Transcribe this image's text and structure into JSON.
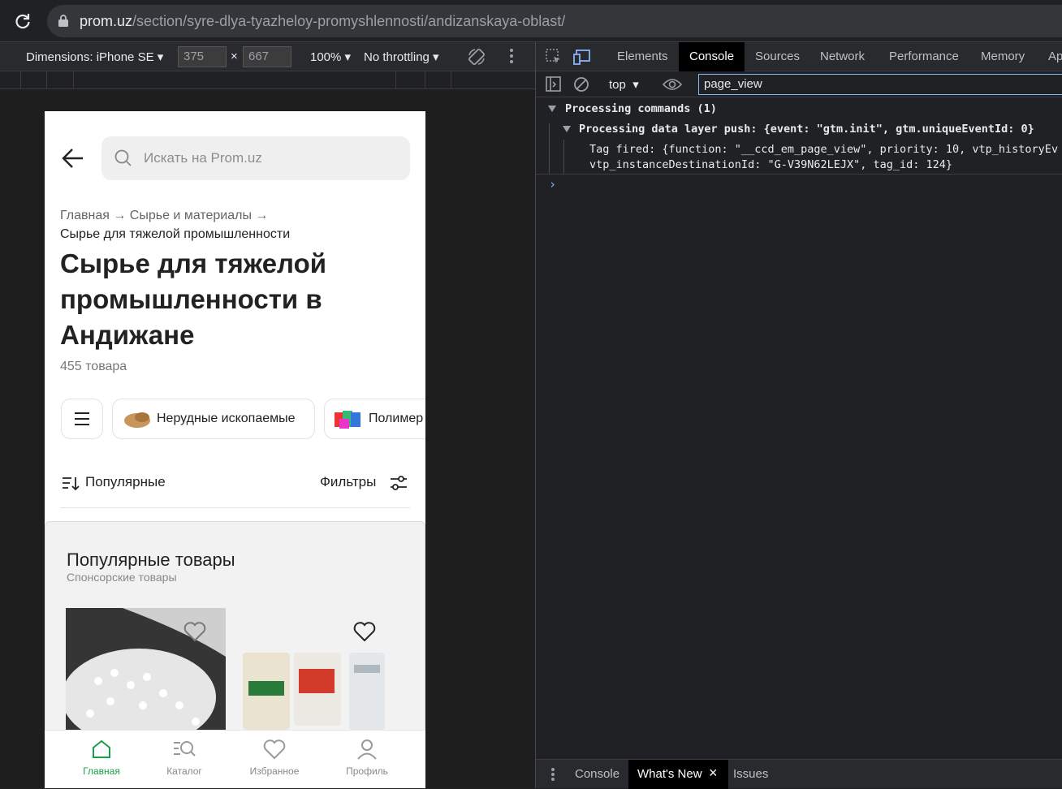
{
  "browser": {
    "url_host": "prom.uz",
    "url_path": "/section/syre-dlya-tyazheloy-promyshlennosti/andizanskaya-oblast/"
  },
  "device_toolbar": {
    "dimensions_label": "Dimensions: iPhone SE",
    "width": "375",
    "height": "667",
    "times": "×",
    "zoom": "100%",
    "throttling": "No throttling"
  },
  "page": {
    "search_placeholder": "Искать на Prom.uz",
    "breadcrumbs": [
      "Главная",
      "Сырье и материалы"
    ],
    "breadcrumb_current": "Сырье для тяжелой промышленности",
    "title": "Сырье для тяжелой промышленности в Андижане",
    "count": "455 товара",
    "chips": [
      "Нерудные ископаемые",
      "Полимер"
    ],
    "sort_label": "Популярные",
    "filters_label": "Фильтры",
    "popular_title": "Популярные товары",
    "popular_subtitle": "Спонсорские товары",
    "nav": [
      "Главная",
      "Каталог",
      "Избранное",
      "Профиль"
    ]
  },
  "devtools": {
    "tabs": [
      "Elements",
      "Console",
      "Sources",
      "Network",
      "Performance",
      "Memory",
      "Ap"
    ],
    "active_tab": "Console",
    "context": "top",
    "filter_value": "page_view",
    "lines": [
      "Processing commands (1)",
      "Processing data layer push: {event: \"gtm.init\", gtm.uniqueEventId: 0}",
      "Tag fired: {function: \"__ccd_em_page_view\", priority: 10, vtp_historyEv",
      "vtp_instanceDestinationId: \"G-V39N62LEJX\", tag_id: 124}"
    ],
    "prompt": "›",
    "drawer_tabs": [
      "Console",
      "What's New",
      "Issues"
    ],
    "drawer_close": "×"
  },
  "colors": {
    "accent_green": "#1a9e4b",
    "devtools_bg": "#202124",
    "filter_border": "#8ab4f8"
  }
}
